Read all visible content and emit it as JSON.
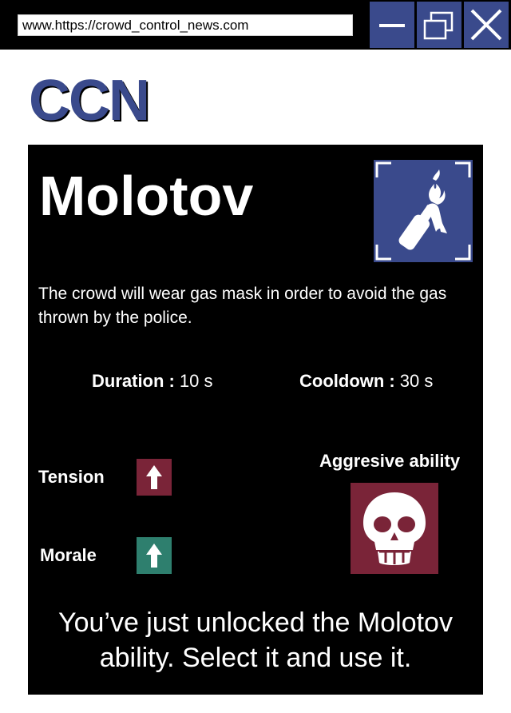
{
  "browser": {
    "url": "www.https://crowd_control_news.com",
    "buttons": {
      "minimize_icon": "minimize-icon",
      "maximize_icon": "maximize-icon",
      "close_icon": "close-icon"
    },
    "accent_color": "#3a4a8c"
  },
  "logo": {
    "text": "CCN"
  },
  "card": {
    "title": "Molotov",
    "ability_icon": "molotov-icon",
    "description": "The crowd will wear gas mask in order to avoid the gas thrown by the police.",
    "stats": {
      "duration_label": "Duration :",
      "duration_value": "10 s",
      "cooldown_label": "Cooldown :",
      "cooldown_value": "30 s"
    },
    "effects": {
      "tension_label": "Tension",
      "tension_icon": "arrow-up-icon",
      "tension_color": "#7a2438",
      "morale_label": "Morale",
      "morale_icon": "arrow-up-icon",
      "morale_color": "#2e7f6e"
    },
    "ability_type": {
      "label": "Aggresive ability",
      "icon": "skull-icon",
      "color": "#7a2438"
    },
    "unlock_message": "You’ve just unlocked the Molotov ability. Select it and use it."
  }
}
